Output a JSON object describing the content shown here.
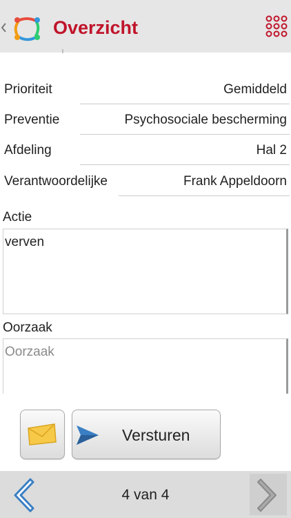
{
  "header": {
    "title": "Overzicht",
    "accent_color": "#c0142a",
    "icons": [
      "back-chevron-icon",
      "app-logo-icon",
      "grid-menu-icon"
    ]
  },
  "fields": [
    {
      "label": "Prioriteit",
      "value": "Gemiddeld"
    },
    {
      "label": "Preventie",
      "value": "Psychosociale bescherming"
    },
    {
      "label": "Afdeling",
      "value": "Hal 2"
    },
    {
      "label": "Verantwoordelijke",
      "value": "Frank Appeldoorn"
    }
  ],
  "actie": {
    "label": "Actie",
    "value": "verven"
  },
  "oorzaak": {
    "label": "Oorzaak",
    "placeholder": "Oorzaak"
  },
  "buttons": {
    "send_label": "Versturen",
    "mail_icon": "envelope-icon",
    "send_icon": "paper-plane-icon"
  },
  "footer": {
    "pager": "4 van 4",
    "prev_icon": "chevron-left-icon",
    "next_icon": "chevron-right-icon"
  }
}
